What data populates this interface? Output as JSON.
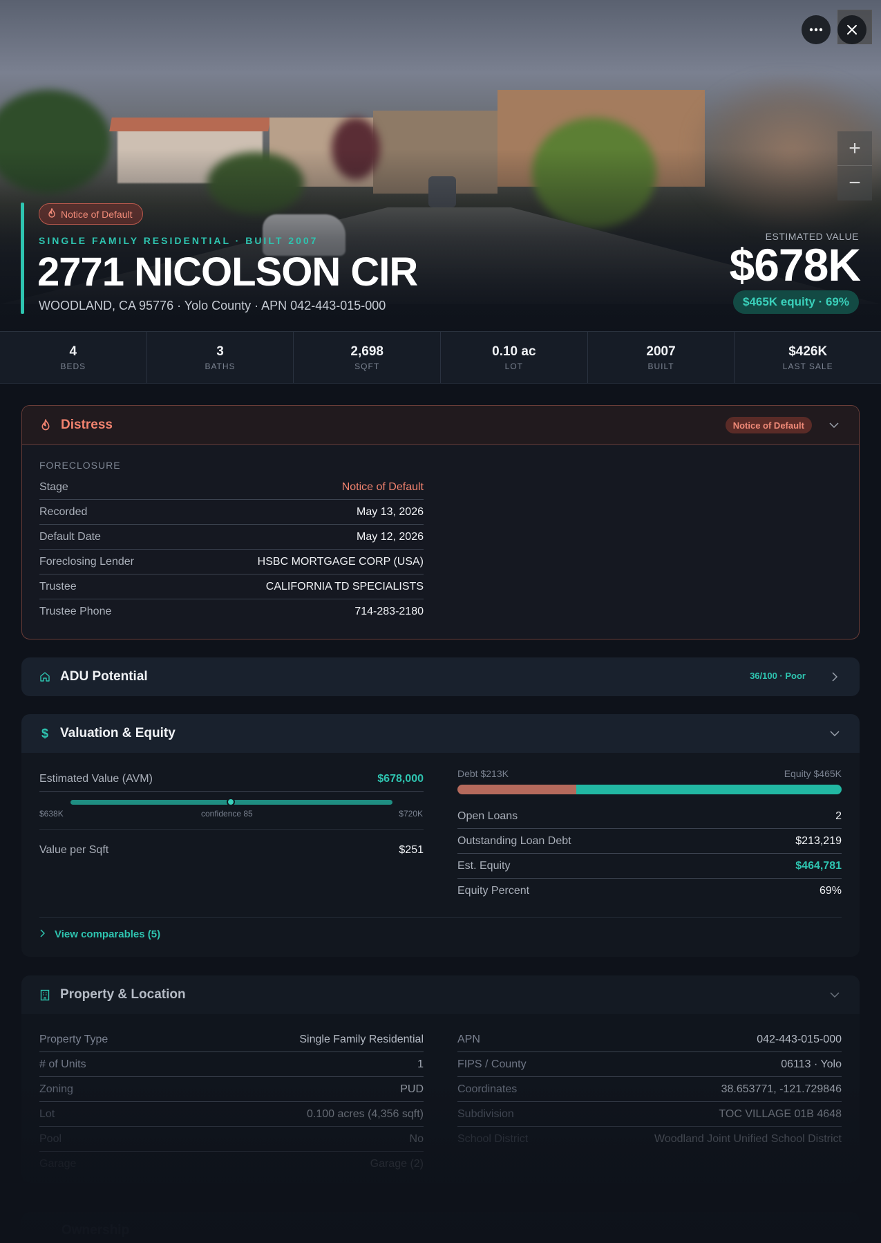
{
  "hero": {
    "badge": "Notice of Default",
    "kicker": "SINGLE FAMILY RESIDENTIAL · BUILT 2007",
    "address": "2771 NICOLSON CIR",
    "subaddress": "WOODLAND, CA 95776 · Yolo County · APN 042-443-015-000",
    "est_label": "ESTIMATED VALUE",
    "est_value": "$678K",
    "equity_chip": "$465K equity · 69%"
  },
  "stats": [
    {
      "value": "4",
      "label": "BEDS"
    },
    {
      "value": "3",
      "label": "BATHS"
    },
    {
      "value": "2,698",
      "label": "SQFT"
    },
    {
      "value": "0.10 ac",
      "label": "LOT"
    },
    {
      "value": "2007",
      "label": "BUILT"
    },
    {
      "value": "$426K",
      "label": "LAST SALE"
    }
  ],
  "distress": {
    "title": "Distress",
    "badge": "Notice of Default",
    "section": "FORECLOSURE",
    "rows": [
      {
        "k": "Stage",
        "v": "Notice of Default"
      },
      {
        "k": "Recorded",
        "v": "May 13, 2026"
      },
      {
        "k": "Default Date",
        "v": "May 12, 2026"
      },
      {
        "k": "Foreclosing Lender",
        "v": "HSBC MORTGAGE CORP (USA)"
      },
      {
        "k": "Trustee",
        "v": "CALIFORNIA TD SPECIALISTS"
      },
      {
        "k": "Trustee Phone",
        "v": "714-283-2180"
      }
    ]
  },
  "adu": {
    "title": "ADU Potential",
    "score": "36/100 · Poor"
  },
  "valuation": {
    "title": "Valuation & Equity",
    "avm_label": "Estimated Value (AVM)",
    "avm_value": "$678,000",
    "range_low": "$638K",
    "confidence": "confidence 85",
    "range_high": "$720K",
    "ppsf_label": "Value per Sqft",
    "ppsf_value": "$251",
    "debt_label": "Debt $213K",
    "equity_label": "Equity $465K",
    "debt_fraction": 0.31,
    "rows": [
      {
        "k": "Open Loans",
        "v": "2"
      },
      {
        "k": "Outstanding Loan Debt",
        "v": "$213,219"
      },
      {
        "k": "Est. Equity",
        "v": "$464,781"
      },
      {
        "k": "Equity Percent",
        "v": "69%"
      }
    ],
    "comparables": "View comparables (5)"
  },
  "property": {
    "title": "Property & Location",
    "left": [
      {
        "k": "Property Type",
        "v": "Single Family Residential"
      },
      {
        "k": "# of Units",
        "v": "1"
      },
      {
        "k": "Zoning",
        "v": "PUD"
      },
      {
        "k": "Lot",
        "v": "0.100 acres (4,356 sqft)"
      },
      {
        "k": "Pool",
        "v": "No"
      },
      {
        "k": "Garage",
        "v": "Garage (2)"
      }
    ],
    "right": [
      {
        "k": "APN",
        "v": "042-443-015-000"
      },
      {
        "k": "FIPS / County",
        "v": "06113 · Yolo"
      },
      {
        "k": "Coordinates",
        "v": "38.653771, -121.729846"
      },
      {
        "k": "Subdivision",
        "v": "TOC VILLAGE 01B 4648"
      },
      {
        "k": "School District",
        "v": "Woodland Joint Unified School District"
      }
    ]
  },
  "ownership": {
    "title": "Ownership"
  },
  "colors": {
    "accent": "#2ec4b0",
    "distress": "#f2836f",
    "debt": "#b56a5c"
  }
}
